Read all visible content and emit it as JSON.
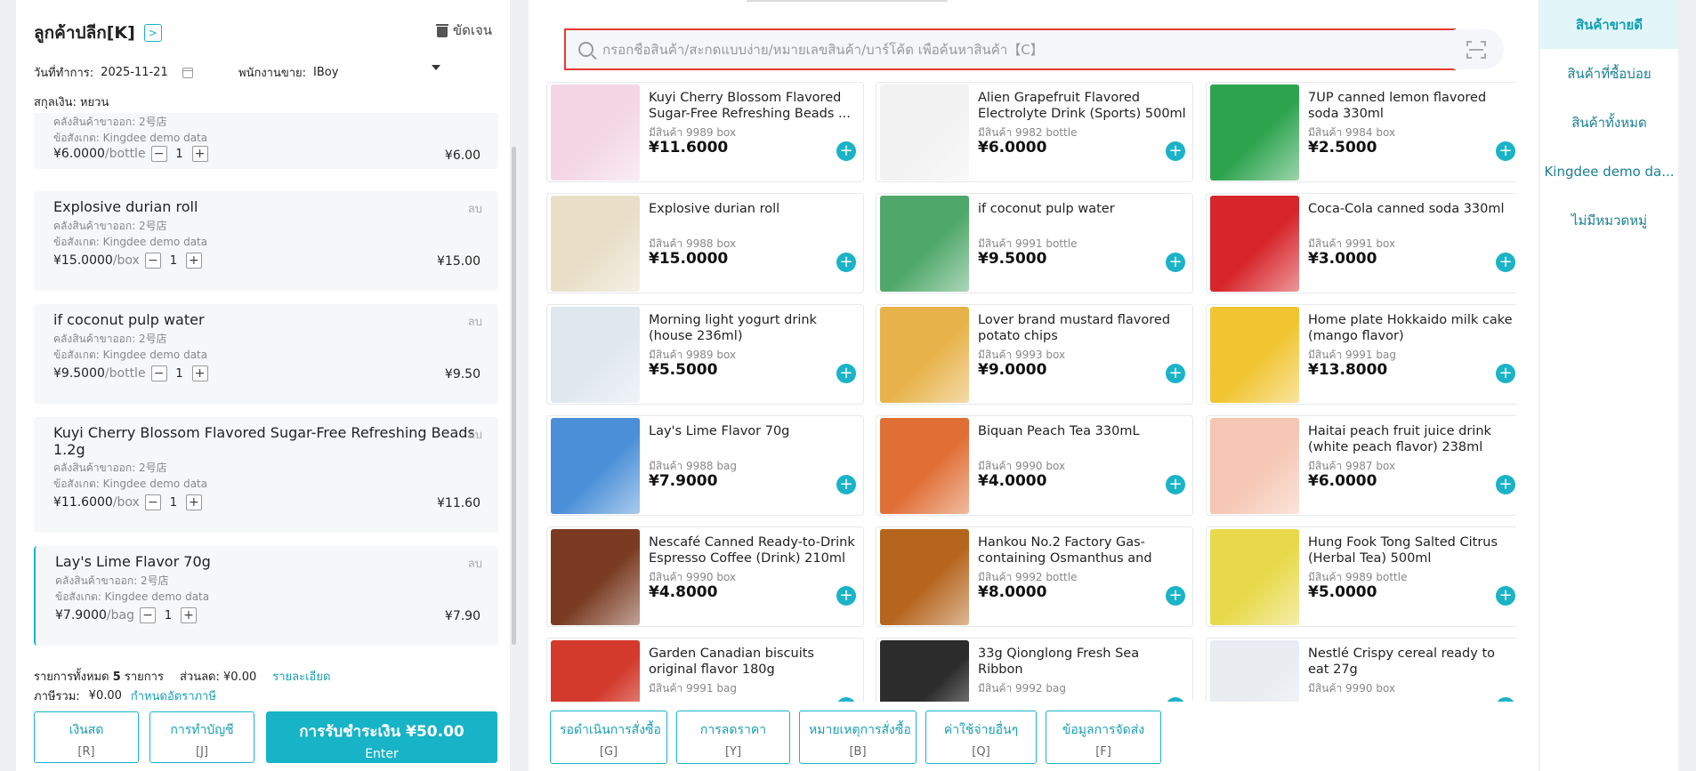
{
  "customer": {
    "title": "ลูกค้าปลีก[K]",
    "clear_label": "ขัดเจน"
  },
  "meta": {
    "date_label": "วันที่ทำการ:",
    "date_value": "2025-11-21",
    "staff_label": "พนักงานขาย:",
    "staff_value": "IBoy",
    "currency_label": "สกุลเงิน:",
    "currency_value": "หยวน"
  },
  "cart": [
    {
      "name": "",
      "warehouse": "คลังสินค้าขาออก: 2号店",
      "remark": "ข้อสังเกต: Kingdee demo data",
      "price": "¥6.0000",
      "unit": "/bottle",
      "qty": "1",
      "total": "¥6.00",
      "del": ""
    },
    {
      "name": "Explosive durian roll",
      "warehouse": "คลังสินค้าขาออก: 2号店",
      "remark": "ข้อสังเกต: Kingdee demo data",
      "price": "¥15.0000",
      "unit": "/box",
      "qty": "1",
      "total": "¥15.00",
      "del": "ลบ"
    },
    {
      "name": "if coconut pulp water",
      "warehouse": "คลังสินค้าขาออก: 2号店",
      "remark": "ข้อสังเกต: Kingdee demo data",
      "price": "¥9.5000",
      "unit": "/bottle",
      "qty": "1",
      "total": "¥9.50",
      "del": "ลบ"
    },
    {
      "name": "Kuyi Cherry Blossom Flavored Sugar-Free Refreshing Beads 1.2g",
      "warehouse": "คลังสินค้าขาออก: 2号店",
      "remark": "ข้อสังเกต: Kingdee demo data",
      "price": "¥11.6000",
      "unit": "/box",
      "qty": "1",
      "total": "¥11.60",
      "del": "ลบ"
    },
    {
      "name": "Lay's Lime Flavor 70g",
      "warehouse": "คลังสินค้าขาออก: 2号店",
      "remark": "ข้อสังเกต: Kingdee demo data",
      "price": "¥7.9000",
      "unit": "/bag",
      "qty": "1",
      "total": "¥7.90",
      "del": "ลบ"
    }
  ],
  "summary": {
    "items_label": "รายการทั้งหมด",
    "items_count": "5",
    "items_unit": "รายการ",
    "discount_label": "ส่วนลด:",
    "discount_value": "¥0.00",
    "detail_link": "รายละเอียด",
    "tax_label": "ภาษีรวม:",
    "tax_value": "¥0.00",
    "tax_link": "กำหนดอัตราภาษี"
  },
  "pay_buttons": {
    "cash": {
      "label": "เงินสด",
      "key": "[R]"
    },
    "account": {
      "label": "การทำบัญชี",
      "key": "[J]"
    },
    "pay": {
      "label": "การรับชำระเงิน ¥50.00",
      "key": "Enter"
    }
  },
  "search": {
    "placeholder": "กรอกชื่อสินค้า/สะกดแบบง่าย/หมายเลขสินค้า/บาร์โค้ด เพื่อค้นหาสินค้า【C】"
  },
  "products": [
    {
      "name": "Kuyi Cherry Blossom Flavored Sugar-Free Refreshing Beads ...",
      "stock": "มีสินค้า 9989 box",
      "price": "¥11.6000",
      "thumb": "#f3d7e4"
    },
    {
      "name": "Alien Grapefruit Flavored Electrolyte Drink (Sports) 500ml",
      "stock": "มีสินค้า 9982 bottle",
      "price": "¥6.0000",
      "thumb": "#f2f2f2"
    },
    {
      "name": "7UP canned lemon flavored soda 330ml",
      "stock": "มีสินค้า 9984 box",
      "price": "¥2.5000",
      "thumb": "#2ea44f"
    },
    {
      "name": "Explosive durian roll",
      "stock": "มีสินค้า 9988 box",
      "price": "¥15.0000",
      "thumb": "#e9dfc9"
    },
    {
      "name": "if coconut pulp water",
      "stock": "มีสินค้า 9991 bottle",
      "price": "¥9.5000",
      "thumb": "#4fa86a"
    },
    {
      "name": "Coca-Cola canned soda 330ml",
      "stock": "มีสินค้า 9991 box",
      "price": "¥3.0000",
      "thumb": "#d6262b"
    },
    {
      "name": "Morning light yogurt drink (house 236ml)",
      "stock": "มีสินค้า 9989 box",
      "price": "¥5.5000",
      "thumb": "#dfe7ef"
    },
    {
      "name": "Lover brand mustard flavored potato chips",
      "stock": "มีสินค้า 9993 box",
      "price": "¥9.0000",
      "thumb": "#e7b24a"
    },
    {
      "name": "Home plate Hokkaido milk cake (mango flavor)",
      "stock": "มีสินค้า 9991 bag",
      "price": "¥13.8000",
      "thumb": "#f1c531"
    },
    {
      "name": "Lay's Lime Flavor 70g",
      "stock": "มีสินค้า 9988 bag",
      "price": "¥7.9000",
      "thumb": "#4a8fd8"
    },
    {
      "name": "Biquan Peach Tea 330mL",
      "stock": "มีสินค้า 9990 box",
      "price": "¥4.0000",
      "thumb": "#e06f36"
    },
    {
      "name": "Haitai peach fruit juice drink (white peach flavor) 238ml",
      "stock": "มีสินค้า 9987 box",
      "price": "¥6.0000",
      "thumb": "#f5c6b3"
    },
    {
      "name": "Nescafé Canned Ready-to-Drink Espresso Coffee (Drink) 210ml",
      "stock": "มีสินค้า 9990 box",
      "price": "¥4.8000",
      "thumb": "#7a3b22"
    },
    {
      "name": "Hankou No.2 Factory Gas-containing Osmanthus and Sou...",
      "stock": "มีสินค้า 9992 bottle",
      "price": "¥8.0000",
      "thumb": "#b5651d"
    },
    {
      "name": "Hung Fook Tong Salted Citrus (Herbal Tea) 500ml",
      "stock": "มีสินค้า 9989 bottle",
      "price": "¥5.0000",
      "thumb": "#e8d94a"
    },
    {
      "name": "Garden Canadian biscuits original flavor 180g",
      "stock": "มีสินค้า 9991 bag",
      "price": "",
      "thumb": "#d33a2c"
    },
    {
      "name": "33g Qionglong Fresh Sea Ribbon",
      "stock": "มีสินค้า 9992 bag",
      "price": "",
      "thumb": "#2c2c2c"
    },
    {
      "name": "Nestlé Crispy cereal ready to eat 27g",
      "stock": "มีสินค้า 9990 box",
      "price": "",
      "thumb": "#e9edf2"
    }
  ],
  "bottom_buttons": [
    {
      "label": "รอดำเนินการสั่งซื้อ",
      "key": "[G]"
    },
    {
      "label": "การลดราคา",
      "key": "[Y]"
    },
    {
      "label": "หมายเหตุการสั่งซื้อ",
      "key": "[B]"
    },
    {
      "label": "ค่าใช้จ่ายอื่นๆ",
      "key": "[Q]"
    },
    {
      "label": "ข้อมูลการจัดส่ง",
      "key": "[F]"
    }
  ],
  "categories": [
    {
      "label": "สินค้าขายดี",
      "active": true
    },
    {
      "label": "สินค้าที่ซื้อบ่อย",
      "active": false
    },
    {
      "label": "สินค้าทั้งหมด",
      "active": false
    },
    {
      "label": "Kingdee demo da...",
      "active": false
    },
    {
      "label": "ไม่มีหมวดหมู่",
      "active": false
    }
  ],
  "colors": {
    "accent": "#1ab3c8",
    "highlight": "#e53935"
  }
}
